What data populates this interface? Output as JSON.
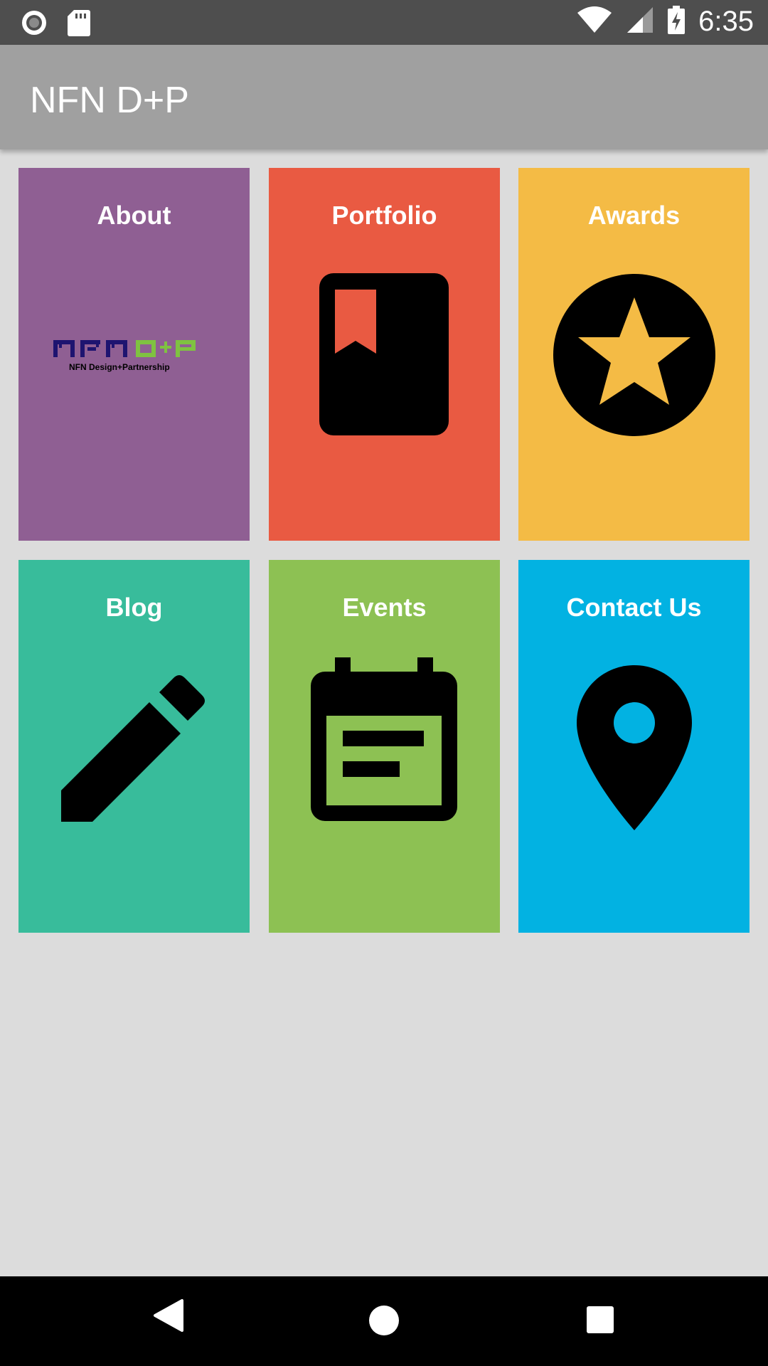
{
  "status_bar": {
    "time": "6:35",
    "icons": [
      "record-icon",
      "sd-card-icon",
      "wifi-icon",
      "signal-icon",
      "battery-charging-icon"
    ]
  },
  "app_bar": {
    "title": "NFN D+P"
  },
  "tiles": [
    {
      "label": "About",
      "color": "#8f5f93",
      "icon": "nfn-logo"
    },
    {
      "label": "Portfolio",
      "color": "#e95a42",
      "icon": "book-icon"
    },
    {
      "label": "Awards",
      "color": "#f4bb45",
      "icon": "star-circle-icon"
    },
    {
      "label": "Blog",
      "color": "#38bc9b",
      "icon": "pencil-icon"
    },
    {
      "label": "Events",
      "color": "#8dc153",
      "icon": "calendar-icon"
    },
    {
      "label": "Contact Us",
      "color": "#02b2e2",
      "icon": "location-pin-icon"
    }
  ],
  "logo": {
    "wordmark": "NFN D+P",
    "tagline": "NFN Design+Partnership"
  },
  "nav_bar": {
    "icons": [
      "back-icon",
      "home-icon",
      "recents-icon"
    ]
  }
}
